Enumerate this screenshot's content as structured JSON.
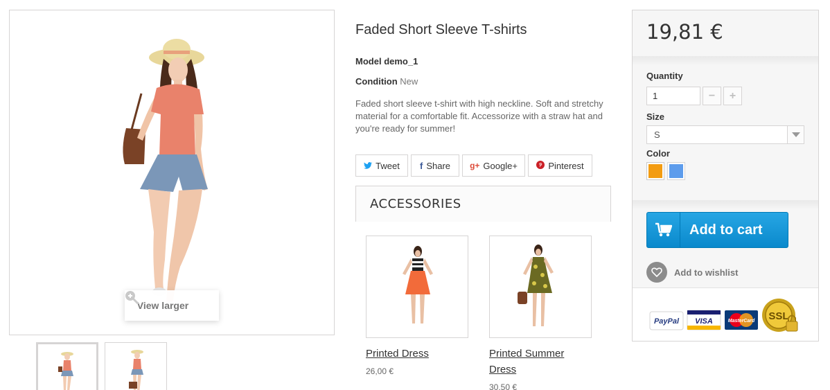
{
  "gallery": {
    "view_larger_label": "View larger"
  },
  "product": {
    "title": "Faded Short Sleeve T-shirts",
    "model_label": "Model",
    "model_value": "demo_1",
    "condition_label": "Condition",
    "condition_value": "New",
    "description": "Faded short sleeve t-shirt with high neckline. Soft and stretchy material for a comfortable fit. Accessorize with a straw hat and you're ready for summer!"
  },
  "social": {
    "tweet": "Tweet",
    "share": "Share",
    "google": "Google+",
    "pinterest": "Pinterest"
  },
  "accessories": {
    "heading": "ACCESSORIES",
    "items": [
      {
        "name_line1": "Printed Dress",
        "name_line2": "",
        "price": "26,00 €"
      },
      {
        "name_line1": "Printed Summer",
        "name_line2": "Dress",
        "price": "30,50 €"
      }
    ]
  },
  "buybox": {
    "price": "19,81 €",
    "quantity_label": "Quantity",
    "quantity_value": "1",
    "minus": "−",
    "plus": "+",
    "size_label": "Size",
    "size_value": "S",
    "color_label": "Color",
    "colors": [
      "#f39c11",
      "#5d9cec"
    ],
    "add_to_cart": "Add to cart",
    "wishlist": "Add to wishlist",
    "payment": {
      "paypal": "PayPal",
      "visa": "VISA",
      "mastercard": "MasterCard",
      "ssl": "SSL"
    }
  },
  "icons": {
    "zoom": "zoom-in-icon",
    "twitter": "twitter-icon",
    "facebook": "facebook-icon",
    "google": "google-plus-icon",
    "pinterest": "pinterest-icon",
    "cart": "cart-icon",
    "heart": "heart-icon",
    "dropdown": "chevron-down-icon"
  },
  "colors": {
    "accent_blue": "#0a89cc",
    "border": "#d6d4d4",
    "twitter": "#1da1f2",
    "facebook": "#3b5998",
    "google": "#dd4b39",
    "pinterest": "#cb2027"
  }
}
